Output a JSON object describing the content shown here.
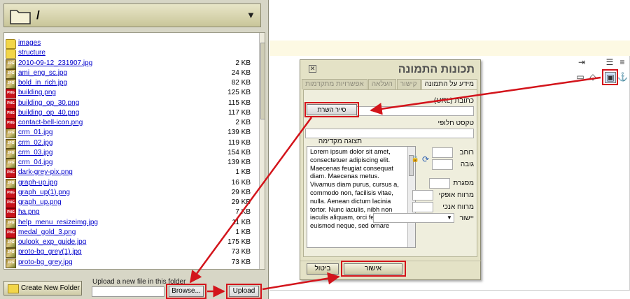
{
  "file_browser": {
    "current_folder": "/",
    "files": [
      {
        "name": "images",
        "type": "folder",
        "size": ""
      },
      {
        "name": "structure",
        "type": "folder",
        "size": ""
      },
      {
        "name": "2010-09-12_231907.jpg",
        "type": "jpg",
        "size": "2 KB"
      },
      {
        "name": "ami_eng_sc.jpg",
        "type": "jpg",
        "size": "24 KB"
      },
      {
        "name": "bold_in_rich.jpg",
        "type": "jpg",
        "size": "82 KB"
      },
      {
        "name": "building.png",
        "type": "png",
        "size": "125 KB"
      },
      {
        "name": "building_op_30.png",
        "type": "png",
        "size": "115 KB"
      },
      {
        "name": "building_op_40.png",
        "type": "png",
        "size": "117 KB"
      },
      {
        "name": "contact-bell-icon.png",
        "type": "png",
        "size": "2 KB"
      },
      {
        "name": "crm_01.jpg",
        "type": "jpg",
        "size": "139 KB"
      },
      {
        "name": "crm_02.jpg",
        "type": "jpg",
        "size": "119 KB"
      },
      {
        "name": "crm_03.jpg",
        "type": "jpg",
        "size": "154 KB"
      },
      {
        "name": "crm_04.jpg",
        "type": "jpg",
        "size": "139 KB"
      },
      {
        "name": "dark-grey-pix.png",
        "type": "png",
        "size": "1 KB"
      },
      {
        "name": "graph-up.jpg",
        "type": "jpg",
        "size": "16 KB"
      },
      {
        "name": "graph_up(1).png",
        "type": "png",
        "size": "29 KB"
      },
      {
        "name": "graph_up.png",
        "type": "png",
        "size": "29 KB"
      },
      {
        "name": "ha.png",
        "type": "png",
        "size": "7 KB"
      },
      {
        "name": "help_menu_resizeimg.jpg",
        "type": "jpg",
        "size": "11 KB"
      },
      {
        "name": "medal_gold_3.png",
        "type": "png",
        "size": "1 KB"
      },
      {
        "name": "oulook_exp_guide.jpg",
        "type": "jpg",
        "size": "175 KB"
      },
      {
        "name": "proto-bg_grey(1).jpg",
        "type": "jpg",
        "size": "73 KB"
      },
      {
        "name": "proto-bg_grey.jpg",
        "type": "jpg",
        "size": "73 KB"
      }
    ],
    "create_folder_label": "Create New Folder",
    "upload_label": "Upload a new file in this folder",
    "browse_label": "Browse...",
    "upload_button": "Upload"
  },
  "dialog": {
    "title": "תכונות התמונה",
    "close_icon": "close-icon",
    "tabs": [
      "מידע על התמונה",
      "קישור",
      "העלאה",
      "אפשרויות מתקדמות"
    ],
    "active_tab": 0,
    "url_label": "כתובת (URL)",
    "browse_server": "סייר השרת",
    "alt_label": "טקסט חלופי",
    "preview_label": "תצוגה מקדימה",
    "preview_text": "Lorem ipsum dolor sit amet, consectetuer adipiscing elit. Maecenas feugiat consequat diam. Maecenas metus. Vivamus diam purus, cursus a, commodo non, facilisis vitae, nulla. Aenean dictum lacinia tortor. Nunc iaculis, nibh non iaculis aliquam, orci felis euismod neque, sed ornare",
    "width_label": "רוחב",
    "height_label": "גובה",
    "border_label": "מסגרת",
    "hspace_label": "מרווח אופקי",
    "vspace_label": "מרווח אנכי",
    "align_label": "יישור",
    "ok_label": "אישור",
    "cancel_label": "ביטול"
  },
  "colors": {
    "highlight": "#d3141b",
    "link": "#0000cc",
    "panel": "#e4e2c6"
  }
}
